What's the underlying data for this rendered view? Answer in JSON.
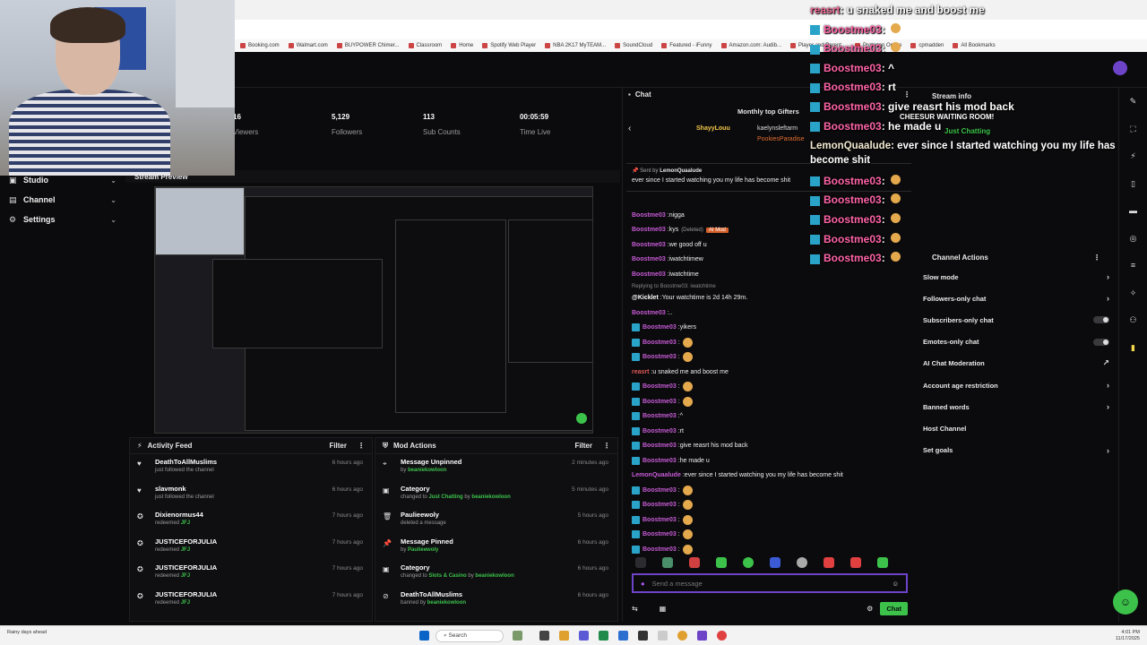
{
  "nav": {
    "items": [
      {
        "label": "Studio",
        "icon": "studio-icon"
      },
      {
        "label": "Channel",
        "icon": "channel-icon"
      },
      {
        "label": "Settings",
        "icon": "settings-icon"
      }
    ]
  },
  "stats": [
    {
      "value": "16",
      "label": "Viewers"
    },
    {
      "value": "5,129",
      "label": "Followers"
    },
    {
      "value": "113",
      "label": "Sub Counts"
    },
    {
      "value": "00:05:59",
      "label": "Time Live"
    }
  ],
  "preview": {
    "title": "Stream Preview"
  },
  "activity": {
    "title": "Activity Feed",
    "filter": "Filter",
    "rows": [
      {
        "icon": "heart-icon",
        "name": "DeathToAllMuslims",
        "sub": "just followed the channel",
        "time": "6 hours ago"
      },
      {
        "icon": "heart-icon",
        "name": "slavmonk",
        "sub": "just followed the channel",
        "time": "6 hours ago"
      },
      {
        "icon": "redeem-icon",
        "name": "Dixienormus44",
        "sub": "redeemed",
        "highlight": "JFJ",
        "time": "7 hours ago"
      },
      {
        "icon": "redeem-icon",
        "name": "JUSTICEFORJULIA",
        "sub": "redeemed",
        "highlight": "JFJ",
        "time": "7 hours ago"
      },
      {
        "icon": "redeem-icon",
        "name": "JUSTICEFORJULIA",
        "sub": "redeemed",
        "highlight": "JFJ",
        "time": "7 hours ago"
      },
      {
        "icon": "redeem-icon",
        "name": "JUSTICEFORJULIA",
        "sub": "redeemed",
        "highlight": "JFJ",
        "time": "7 hours ago"
      }
    ]
  },
  "mod_actions": {
    "title": "Mod Actions",
    "filter": "Filter",
    "rows": [
      {
        "icon": "unpin-icon",
        "name": "Message Unpinned",
        "sub": "by",
        "highlight": "beaniekowloon",
        "time": "2 minutes ago"
      },
      {
        "icon": "category-icon",
        "name": "Category",
        "sub": "changed to",
        "highlight": "Just Chatting",
        "sub2": "by",
        "highlight2": "beaniekowloon",
        "time": "5 minutes ago"
      },
      {
        "icon": "trash-icon",
        "name": "Paulieewoly",
        "sub": "deleted a message",
        "time": "5 hours ago"
      },
      {
        "icon": "pin-icon",
        "name": "Message Pinned",
        "sub": "by",
        "highlight": "Paulieewoly",
        "time": "6 hours ago"
      },
      {
        "icon": "category-icon",
        "name": "Category",
        "sub": "changed to",
        "highlight": "Slots & Casino",
        "sub2": "by",
        "highlight2": "beaniekowloon",
        "time": "6 hours ago"
      },
      {
        "icon": "ban-icon",
        "name": "DeathToAllMuslims",
        "sub": "banned by",
        "highlight": "beaniekowloon",
        "time": "6 hours ago"
      }
    ]
  },
  "chat": {
    "title": "Chat",
    "gifters_title": "Monthly top Gifters",
    "gifters": [
      "ShayyLouu",
      "kaelynsleftarm",
      "PookiesParadise"
    ],
    "pinned_by_label": "Sent by",
    "pinned_by": "LemonQuaalude",
    "pinned_text": "ever since I started watching you my life has become shit",
    "messages": [
      {
        "user": "Boostme03",
        "text": "nigga",
        "style": "purple"
      },
      {
        "user": "Boostme03",
        "text": "kys",
        "tag": "(Deleted)",
        "mod": "AI Mod",
        "style": "purple"
      },
      {
        "user": "Boostme03",
        "text": "we good off u",
        "style": "purple"
      },
      {
        "user": "Boostme03",
        "text": "iwatchtimew",
        "style": "purple"
      },
      {
        "user": "Boostme03",
        "text": "iwatchtime",
        "style": "purple"
      },
      {
        "reply": "Replying to Boostme03: iwatchtime"
      },
      {
        "user": "@Kicklet",
        "text": "Your watchtime is 2d 14h 29m.",
        "style": "white"
      },
      {
        "user": "Boostme03",
        "text": "..",
        "style": "purple"
      },
      {
        "user": "Boostme03",
        "text": "yikers",
        "style": "purple",
        "badge": true
      },
      {
        "user": "Boostme03",
        "emote": true,
        "style": "purple",
        "badge": true
      },
      {
        "user": "Boostme03",
        "emote": true,
        "style": "purple",
        "badge": true
      },
      {
        "user": "reasrt",
        "text": "u snaked me and boost me",
        "style": "red"
      },
      {
        "user": "Boostme03",
        "emote": true,
        "style": "purple",
        "badge": true
      },
      {
        "user": "Boostme03",
        "emote": true,
        "style": "purple",
        "badge": true
      },
      {
        "user": "Boostme03",
        "text": "^",
        "style": "purple",
        "badge": true
      },
      {
        "user": "Boostme03",
        "text": "rt",
        "style": "purple",
        "badge": true
      },
      {
        "user": "Boostme03",
        "text": "give reasrt his mod back",
        "style": "purple",
        "badge": true
      },
      {
        "user": "Boostme03",
        "text": "he made u",
        "style": "purple",
        "badge": true
      },
      {
        "user": "LemonQuaalude",
        "text": "ever since I started watching you my life has become shit",
        "style": "purple"
      },
      {
        "user": "Boostme03",
        "emote": true,
        "style": "purple",
        "badge": true
      },
      {
        "user": "Boostme03",
        "emote": true,
        "style": "purple",
        "badge": true
      },
      {
        "user": "Boostme03",
        "emote": true,
        "style": "purple",
        "badge": true
      },
      {
        "user": "Boostme03",
        "emote": true,
        "style": "purple",
        "badge": true
      },
      {
        "user": "Boostme03",
        "emote": true,
        "style": "purple",
        "badge": true
      }
    ],
    "input_placeholder": "Send a message",
    "send_label": "Chat"
  },
  "stream_info": {
    "title": "Stream info"
  },
  "channel_actions": {
    "title": "Channel Actions",
    "items": [
      {
        "label": "Slow mode",
        "control": "chevron"
      },
      {
        "label": "Followers-only chat",
        "control": "chevron"
      },
      {
        "label": "Subscribers-only chat",
        "control": "toggle"
      },
      {
        "label": "Emotes-only chat",
        "control": "toggle"
      },
      {
        "label": "AI Chat Moderation",
        "control": "external"
      },
      {
        "label": "Account age restriction",
        "control": "chevron"
      },
      {
        "label": "Banned words",
        "control": "chevron"
      },
      {
        "label": "Host Channel",
        "control": "none"
      },
      {
        "label": "Set goals",
        "control": "chevron"
      }
    ]
  },
  "overlay": {
    "lines": [
      {
        "user": "reasrt",
        "text": "u snaked me and boost me",
        "kind": "reas"
      },
      {
        "user": "Boostme03",
        "emote": true
      },
      {
        "user": "Boostme03",
        "emote": true
      },
      {
        "user": "Boostme03",
        "text": "^"
      },
      {
        "user": "Boostme03",
        "text": "rt"
      },
      {
        "user": "Boostme03",
        "text": "give reasrt his mod back"
      },
      {
        "user": "Boostme03",
        "text": "he made u"
      },
      {
        "user": "LemonQuaalude",
        "text": "ever since I started watching you my life has become shit",
        "kind": "lemon"
      },
      {
        "user": "Boostme03",
        "emote": true
      },
      {
        "user": "Boostme03",
        "emote": true
      },
      {
        "user": "Boostme03",
        "emote": true
      },
      {
        "user": "Boostme03",
        "emote": true
      },
      {
        "user": "Boostme03",
        "emote": true
      }
    ],
    "waiting": "CHEESUR WAITING ROOM!",
    "category": "Just Chatting"
  },
  "bookmarks": [
    "Booking.com",
    "Walmart.com",
    "BUYPOWER Chimer...",
    "Classroom",
    "Home",
    "Spotify Web Player",
    "NBA 2K17 MyTEAM...",
    "SoundCloud",
    "Featured - iFunny",
    "Amazon.com: Audib...",
    "Player and Parent...",
    "Protogen Online",
    "cpmadden",
    "All Bookmarks"
  ],
  "taskbar": {
    "weather": "Rainy days ahead",
    "search": "Search",
    "time": "4:01 PM",
    "date": "11/17/2025"
  }
}
